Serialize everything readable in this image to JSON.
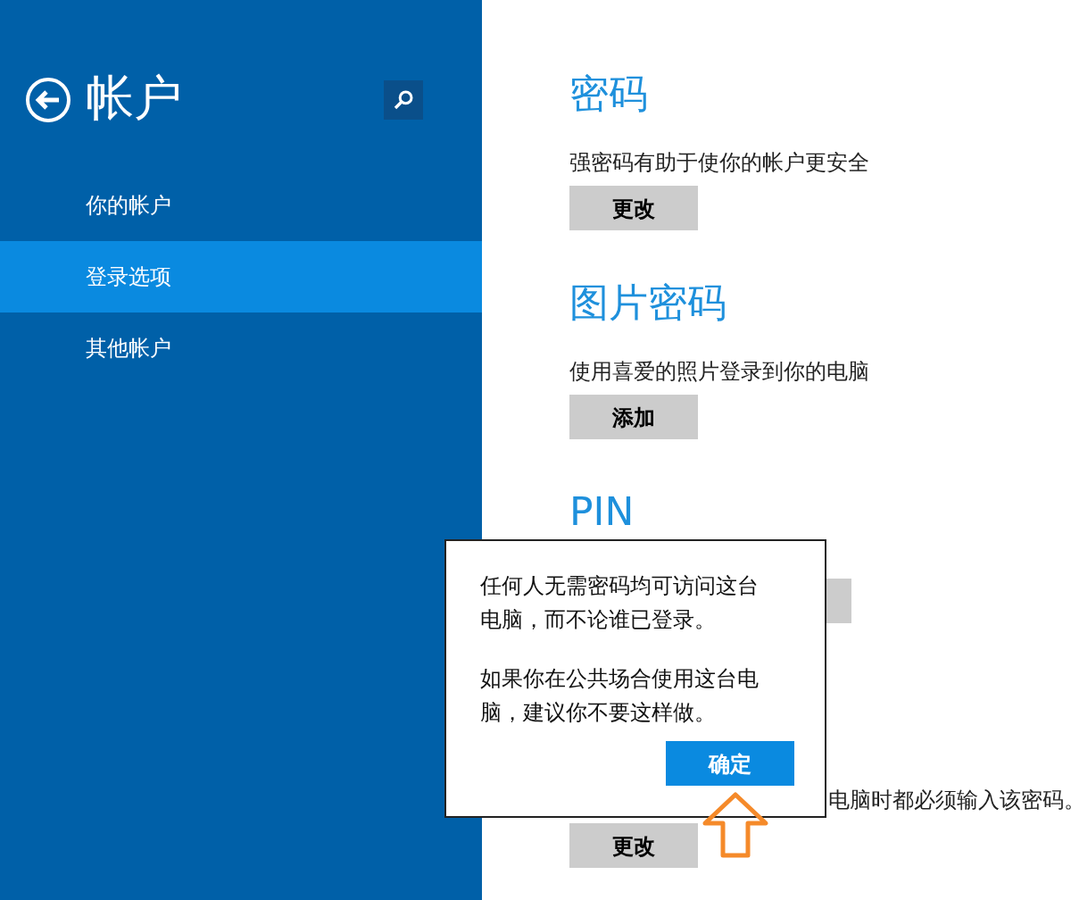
{
  "sidebar": {
    "title": "帐户",
    "items": [
      {
        "label": "你的帐户",
        "selected": false
      },
      {
        "label": "登录选项",
        "selected": true
      },
      {
        "label": "其他帐户",
        "selected": false
      }
    ]
  },
  "sections": [
    {
      "title": "密码",
      "description": "强密码有助于使你的帐户更安全",
      "button": "更改"
    },
    {
      "title": "图片密码",
      "description": "使用喜爱的照片登录到你的电脑",
      "button": "添加"
    },
    {
      "title": "PIN"
    }
  ],
  "partial_text": "电脑时都必须输入该密码。",
  "last_button": "更改",
  "dialog": {
    "paragraphs": [
      "任何人无需密码均可访问这台电脑，而不论谁已登录。",
      "如果你在公共场合使用这台电脑，建议你不要这样做。"
    ],
    "button": "确定"
  }
}
